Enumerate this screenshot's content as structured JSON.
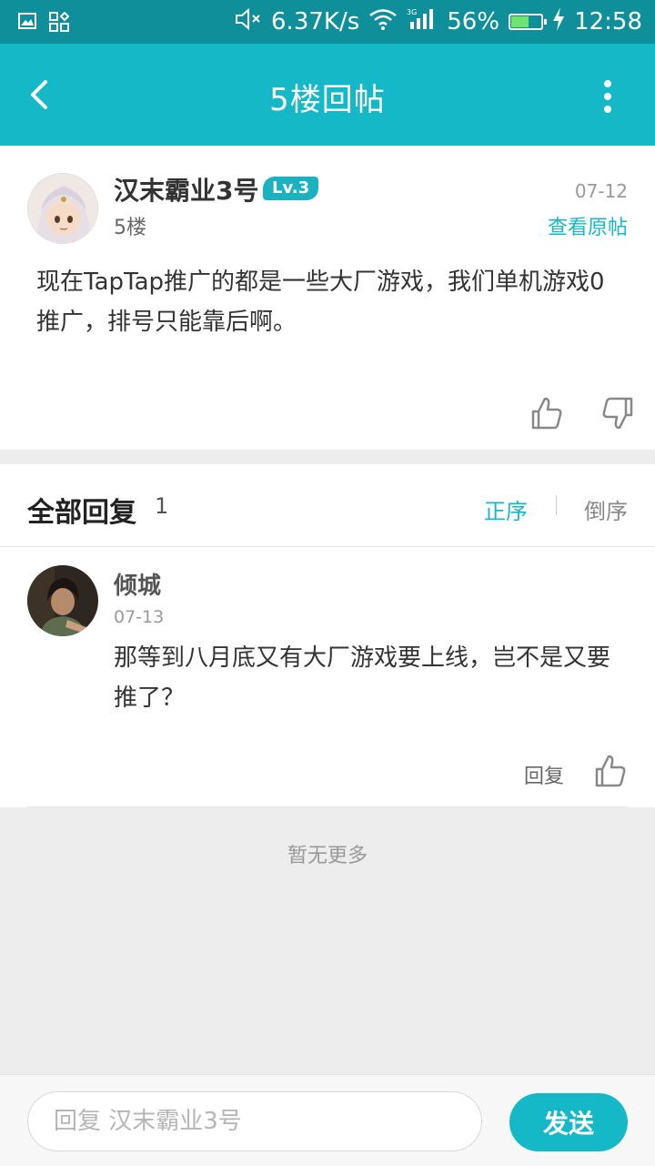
{
  "status_bar": {
    "net_speed": "6.37K/s",
    "battery": "56%",
    "time": "12:58",
    "icons": [
      "image-icon",
      "apps-icon",
      "mute-icon",
      "wifi-icon",
      "signal-icon",
      "battery-icon",
      "charging-icon"
    ]
  },
  "header": {
    "title": "5楼回帖",
    "back_icon": "chevron-left-icon",
    "more_icon": "more-vertical-icon"
  },
  "post": {
    "author": "汉末霸业3号",
    "level": "Lv.3",
    "floor": "5楼",
    "date": "07-12",
    "view_original": "查看原帖",
    "content": "现在TapTap推广的都是一些大厂游戏，我们单机游戏0推广，排号只能靠后啊。"
  },
  "replies_header": {
    "title": "全部回复",
    "count": "1",
    "sort_asc": "正序",
    "sort_desc": "倒序"
  },
  "replies": [
    {
      "author": "倾城",
      "date": "07-13",
      "content": "那等到八月底又有大厂游戏要上线，岂不是又要推了？",
      "reply_label": "回复"
    }
  ],
  "no_more": "暂无更多",
  "input": {
    "placeholder": "回复 汉末霸业3号",
    "value": "",
    "send_label": "发送"
  },
  "colors": {
    "accent": "#15b8c6",
    "status_bar": "#0f8f99"
  }
}
